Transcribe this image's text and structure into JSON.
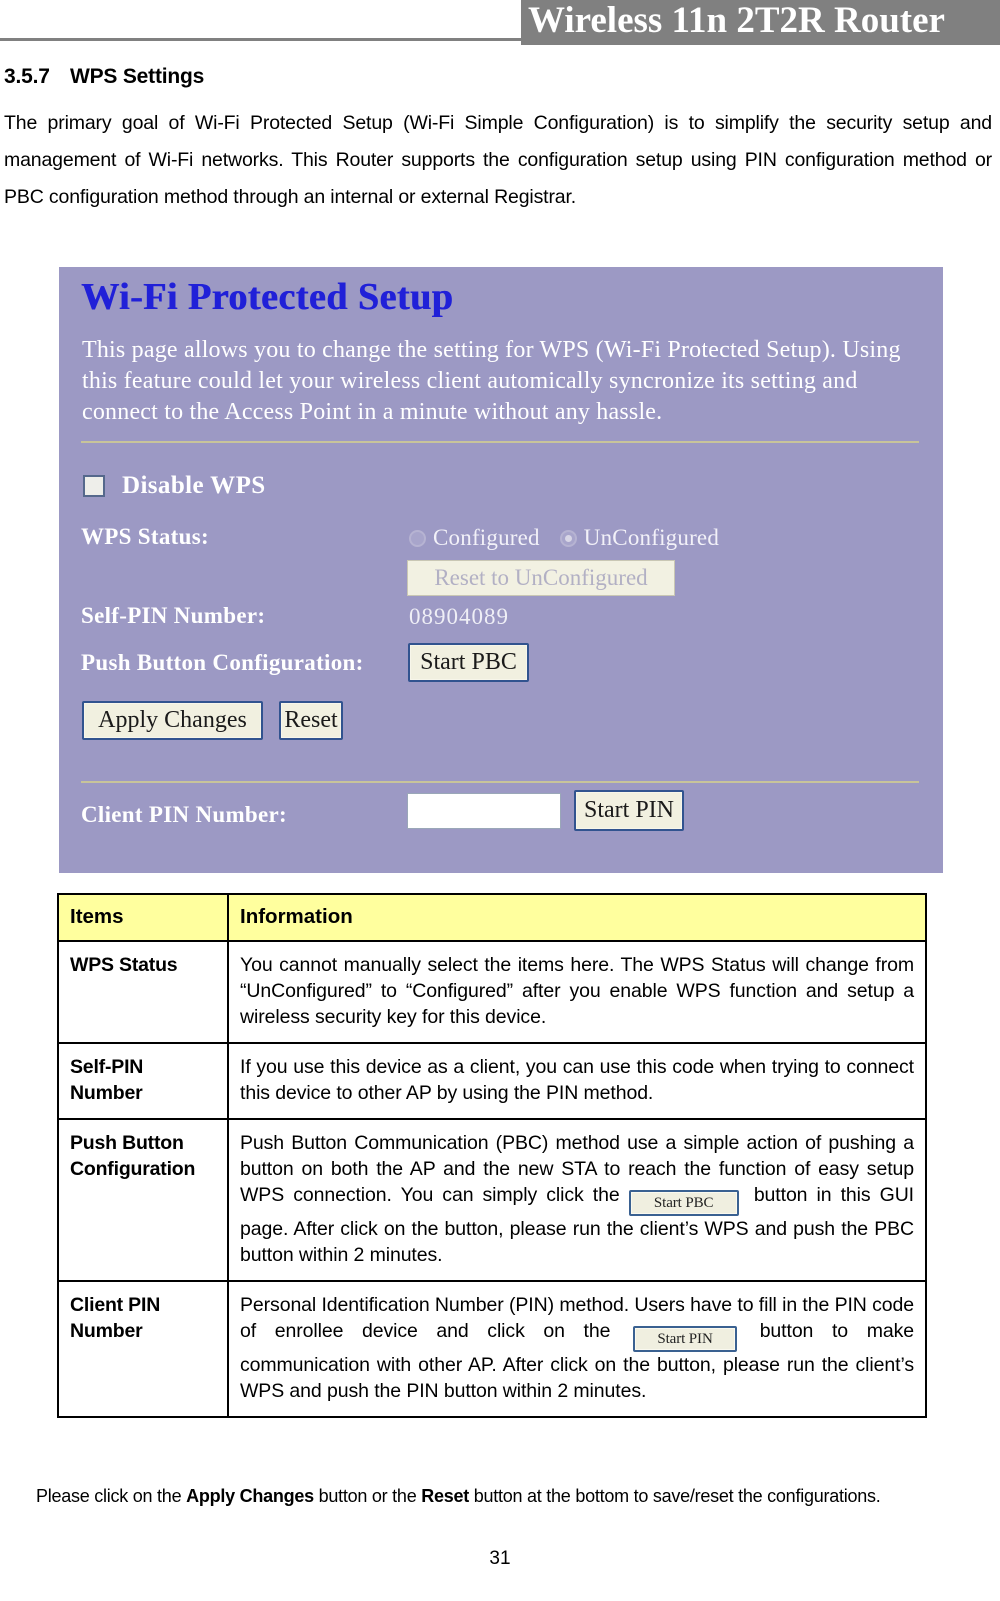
{
  "header": {
    "title": "Wireless 11n 2T2R Router"
  },
  "section": {
    "number": "3.5.7",
    "title": "WPS Settings",
    "intro": "The primary goal of Wi-Fi Protected Setup (Wi-Fi Simple Configuration) is to simplify the security setup and management of Wi-Fi networks. This Router supports the configuration setup using PIN configuration method or PBC configuration method through an internal or external Registrar."
  },
  "wps_screenshot": {
    "title": "Wi-Fi Protected Setup",
    "description": "This page allows you to change the setting for WPS (Wi-Fi Protected Setup). Using this feature could let your wireless client automically syncronize its setting and connect to the Access Point in a minute without any hassle.",
    "disable_wps_label": "Disable WPS",
    "disable_wps_checked": false,
    "wps_status_label": "WPS Status:",
    "status_options": [
      {
        "label": "Configured",
        "selected": false
      },
      {
        "label": "UnConfigured",
        "selected": true
      }
    ],
    "reset_unconfigured_label": "Reset to UnConfigured",
    "self_pin_label": "Self-PIN Number:",
    "self_pin_value": "08904089",
    "pbc_label": "Push Button Configuration:",
    "start_pbc_label": "Start PBC",
    "apply_changes_label": "Apply Changes",
    "reset_label": "Reset",
    "client_pin_label": "Client PIN Number:",
    "client_pin_value": "",
    "client_pin_placeholder": "",
    "start_pin_label": "Start PIN",
    "panel_color": "#9c99c4",
    "title_color": "#2020d8",
    "divider_color": "#c8c49a"
  },
  "info_table": {
    "headers": [
      "Items",
      "Information"
    ],
    "rows": [
      {
        "item": "WPS Status",
        "info": "You cannot manually select the items here. The WPS Status will change from “UnConfigured” to “Configured” after you enable WPS function and setup a wireless security key for this device."
      },
      {
        "item": "Self-PIN Number",
        "info": "If you use this device as a client, you can use this code when trying to connect this device to other AP by using the PIN method."
      },
      {
        "item": "Push Button Configuration",
        "info_part1": "Push Button Communication (PBC) method use a simple action of pushing a button on both the AP and the new STA to reach the function of easy setup WPS connection. You can simply click the",
        "inline_button": "Start PBC",
        "info_part2": "button in this GUI page. After click on the button, please run the client’s WPS and push the PBC button within 2 minutes."
      },
      {
        "item": "Client PIN Number",
        "info_part1": "Personal Identification Number (PIN) method. Users have to fill in the PIN code of enrollee device and click on the",
        "inline_button": "Start PIN",
        "info_part2": "button to make communication with other AP. After click on the button, please run the client’s WPS and push the PIN button within 2 minutes."
      }
    ],
    "header_bg": "#ffff9e"
  },
  "footer": {
    "note_prefix": "Please click on the ",
    "note_bold1": "Apply Changes",
    "note_mid": " button or the ",
    "note_bold2": "Reset",
    "note_suffix": " button at the bottom to save/reset the configurations.",
    "page_number": "31"
  }
}
